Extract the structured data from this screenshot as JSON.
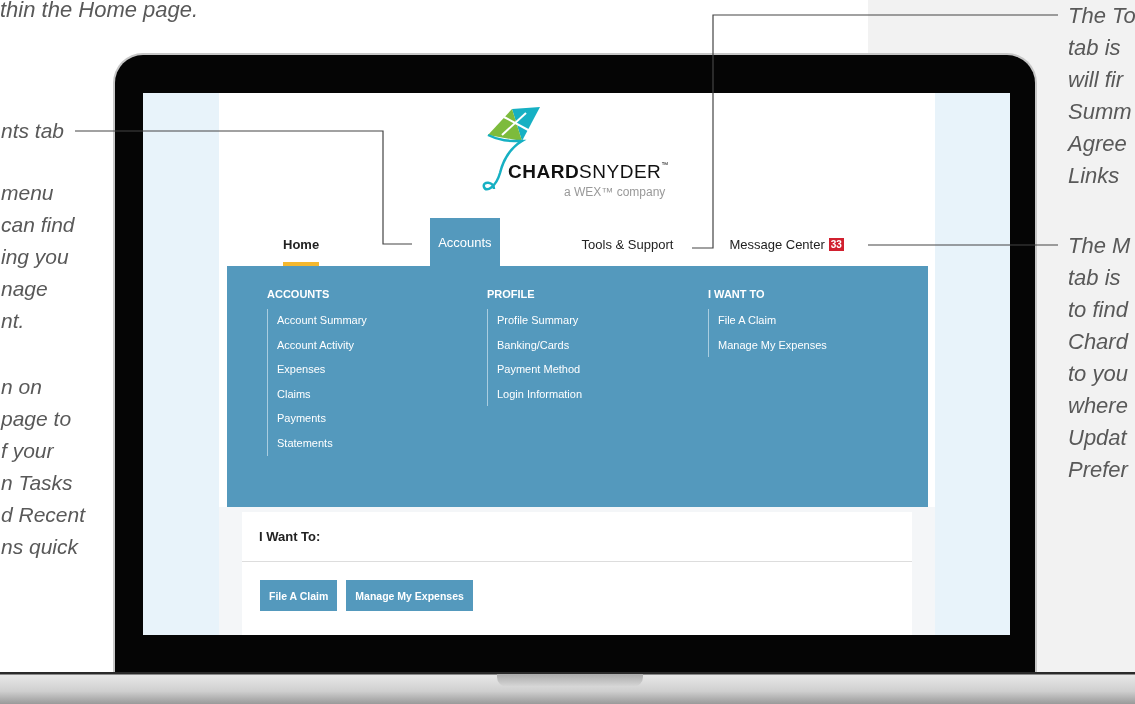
{
  "top_note": "thin the Home page.",
  "left_notes": [
    {
      "lines": [
        "nts tab"
      ]
    },
    {
      "lines": [
        "menu",
        "can find",
        "ing you",
        "nage",
        "nt."
      ]
    },
    {
      "lines": [
        "n on",
        "page to",
        "f your",
        "n Tasks",
        "d Recent",
        "ns quick"
      ]
    }
  ],
  "right_notes": [
    {
      "lines": [
        "The To",
        "tab is",
        "will fir",
        "Summ",
        "Agree",
        "Links"
      ]
    },
    {
      "lines": [
        "The M",
        "tab is",
        "to find",
        "Chard",
        "to you",
        "where",
        "Updat",
        "Prefer"
      ]
    }
  ],
  "logo": {
    "wordmark": "**CHARD**SNYDER$^{™}$",
    "tagline": "a WEX™ company"
  },
  "tabs": [
    {
      "label": "Home",
      "current": true,
      "selected": false
    },
    {
      "label": "Accounts",
      "current": false,
      "selected": true
    },
    {
      "label": "Tools & Support",
      "current": false,
      "selected": false
    },
    {
      "label": "Message Center",
      "badge": "33",
      "current": false,
      "selected": false
    }
  ],
  "menu": [
    {
      "heading": "ACCOUNTS",
      "items": [
        "Account Summary",
        "Account Activity",
        "Expenses",
        "Claims",
        "Payments",
        "Statements"
      ]
    },
    {
      "heading": "PROFILE",
      "items": [
        "Profile Summary",
        "Banking/Cards",
        "Payment Method",
        "Login Information"
      ]
    },
    {
      "heading": "I WANT TO",
      "items": [
        "File A Claim",
        "Manage My Expenses"
      ]
    }
  ],
  "card": {
    "title": "I Want To:",
    "buttons": [
      "File A Claim",
      "Manage My Expenses"
    ]
  }
}
